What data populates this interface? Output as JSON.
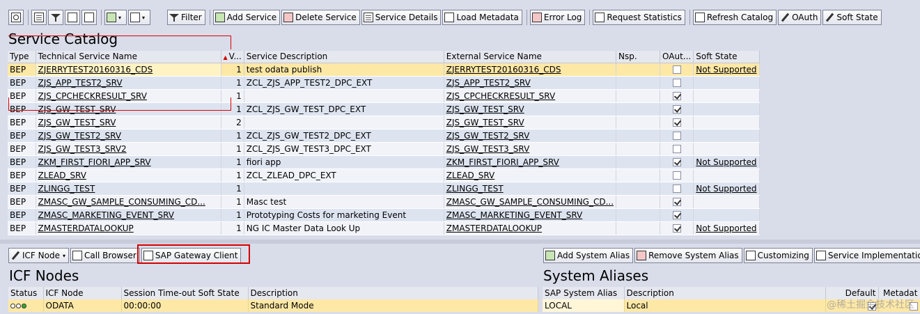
{
  "toolbar": {
    "buttons": [
      {
        "label": "Filter",
        "icon": "filter-icon"
      },
      {
        "label": "Add Service",
        "icon": "add-service-icon"
      },
      {
        "label": "Delete Service",
        "icon": "delete-service-icon"
      },
      {
        "label": "Service Details",
        "icon": "service-details-icon"
      },
      {
        "label": "Load Metadata",
        "icon": "load-metadata-icon"
      },
      {
        "label": "Error Log",
        "icon": "error-log-icon"
      },
      {
        "label": "Request Statistics",
        "icon": "request-statistics-icon"
      },
      {
        "label": "Refresh Catalog",
        "icon": "refresh-catalog-icon"
      },
      {
        "label": "OAuth",
        "icon": "oauth-icon"
      },
      {
        "label": "Soft State",
        "icon": "soft-state-icon"
      }
    ]
  },
  "catalog": {
    "title": "Service Catalog",
    "columns": [
      "Type",
      "Technical Service Name",
      "V...",
      "Service Description",
      "External Service Name",
      "Nsp.",
      "OAut...",
      "Soft State"
    ],
    "rows": [
      {
        "type": "BEP",
        "tech": "ZJERRYTEST20160316_CDS",
        "v": "1",
        "desc": "test odata publish",
        "ext": "ZJERRYTEST20160316_CDS",
        "nsp": "",
        "oauth": false,
        "soft": "Not Supported",
        "selected": true
      },
      {
        "type": "BEP",
        "tech": "ZJS_APP_TEST2_SRV",
        "v": "1",
        "desc": "ZCL_ZJS_APP_TEST2_DPC_EXT",
        "ext": "ZJS_APP_TEST2_SRV",
        "nsp": "",
        "oauth": false,
        "soft": ""
      },
      {
        "type": "BEP",
        "tech": "ZJS_CPCHECKRESULT_SRV",
        "v": "1",
        "desc": "",
        "ext": "ZJS_CPCHECKRESULT_SRV",
        "nsp": "",
        "oauth": true,
        "soft": ""
      },
      {
        "type": "BEP",
        "tech": "ZJS_GW_TEST_SRV",
        "v": "1",
        "desc": "ZCL_ZJS_GW_TEST_DPC_EXT",
        "ext": "ZJS_GW_TEST_SRV",
        "nsp": "",
        "oauth": true,
        "soft": ""
      },
      {
        "type": "BEP",
        "tech": "ZJS_GW_TEST_SRV",
        "v": "2",
        "desc": "",
        "ext": "ZJS_GW_TEST_SRV",
        "nsp": "",
        "oauth": true,
        "soft": ""
      },
      {
        "type": "BEP",
        "tech": "ZJS_GW_TEST2_SRV",
        "v": "1",
        "desc": "ZCL_ZJS_GW_TEST2_DPC_EXT",
        "ext": "ZJS_GW_TEST2_SRV",
        "nsp": "",
        "oauth": false,
        "soft": ""
      },
      {
        "type": "BEP",
        "tech": "ZJS_GW_TEST3_SRV2",
        "v": "1",
        "desc": "ZCL_ZJS_GW_TEST3_DPC_EXT",
        "ext": "ZJS_GW_TEST3_SRV",
        "nsp": "",
        "oauth": false,
        "soft": ""
      },
      {
        "type": "BEP",
        "tech": "ZKM_FIRST_FIORI_APP_SRV",
        "v": "1",
        "desc": "fiori app",
        "ext": "ZKM_FIRST_FIORI_APP_SRV",
        "nsp": "",
        "oauth": true,
        "soft": "Not Supported"
      },
      {
        "type": "BEP",
        "tech": "ZLEAD_SRV",
        "v": "1",
        "desc": "ZCL_ZLEAD_DPC_EXT",
        "ext": "ZLEAD_SRV",
        "nsp": "",
        "oauth": false,
        "soft": ""
      },
      {
        "type": "BEP",
        "tech": "ZLINGG_TEST",
        "v": "1",
        "desc": "",
        "ext": "ZLINGG_TEST",
        "nsp": "",
        "oauth": false,
        "soft": "Not Supported"
      },
      {
        "type": "BEP",
        "tech": "ZMASC_GW_SAMPLE_CONSUMING_CD...",
        "v": "1",
        "desc": "Masc test",
        "ext": "ZMASC_GW_SAMPLE_CONSUMING_CD...",
        "nsp": "",
        "oauth": true,
        "soft": ""
      },
      {
        "type": "BEP",
        "tech": "ZMASC_MARKETING_EVENT_SRV",
        "v": "1",
        "desc": "Prototyping Costs for marketing Event",
        "ext": "ZMASC_MARKETING_EVENT_SRV",
        "nsp": "",
        "oauth": true,
        "soft": ""
      },
      {
        "type": "BEP",
        "tech": "ZMASTERDATALOOKUP",
        "v": "1",
        "desc": "NG IC Master Data Look Up",
        "ext": "ZMASTERDATALOOKUP",
        "nsp": "",
        "oauth": true,
        "soft": "Not Supported"
      }
    ]
  },
  "icf": {
    "buttons": [
      "ICF Node",
      "Call Browser",
      "SAP Gateway Client"
    ],
    "title": "ICF Nodes",
    "columns": [
      "Status",
      "ICF Node",
      "Session Time-out Soft State",
      "Description"
    ],
    "row": {
      "node": "ODATA",
      "timeout": "00:00:00",
      "desc": "Standard Mode"
    }
  },
  "aliases": {
    "buttons": [
      "Add System Alias",
      "Remove System Alias",
      "Customizing",
      "Service Implementation"
    ],
    "title": "System Aliases",
    "columns": [
      "SAP System Alias",
      "Description",
      "Default",
      "Metadat"
    ],
    "row": {
      "alias": "LOCAL",
      "desc": "Local"
    }
  },
  "watermark": "@稀土掘金技术社区"
}
